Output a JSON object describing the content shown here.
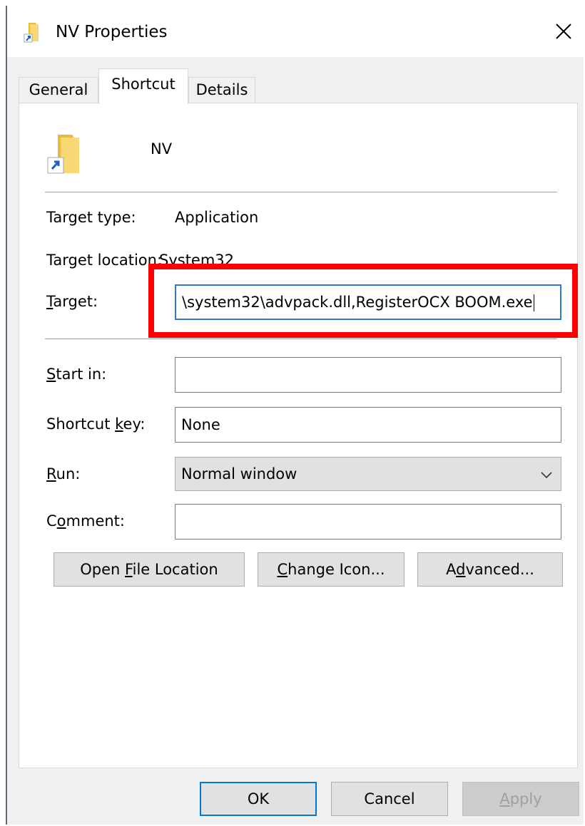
{
  "window": {
    "title": "NV Properties",
    "icons": {
      "title_icon": "folder-shortcut-icon",
      "close_icon": "close-icon",
      "shortcut_icon": "folder-shortcut-icon"
    }
  },
  "tabs": [
    {
      "label": "General",
      "active": false
    },
    {
      "label": "Shortcut",
      "active": true
    },
    {
      "label": "Details",
      "active": false
    }
  ],
  "shortcut": {
    "name": "NV",
    "target_type_label": "Target type:",
    "target_type_value": "Application",
    "target_location_label": "Target location:",
    "target_location_value": "System32",
    "target_label_pre": "",
    "target_label_underlined": "T",
    "target_label_post": "arget:",
    "target_value": "\\system32\\advpack.dll,RegisterOCX BOOM.exe",
    "start_in_label_underlined": "S",
    "start_in_label_post": "tart in:",
    "start_in_value": "",
    "shortcut_key_label_pre": "Shortcut ",
    "shortcut_key_label_underlined": "k",
    "shortcut_key_label_post": "ey:",
    "shortcut_key_value": "None",
    "run_label_underlined": "R",
    "run_label_post": "un:",
    "run_value": "Normal window",
    "comment_label_pre": "C",
    "comment_label_underlined": "o",
    "comment_label_post": "mment:",
    "comment_value": ""
  },
  "buttons": {
    "open_file_location_pre": "Open ",
    "open_file_location_underlined": "F",
    "open_file_location_post": "ile Location",
    "change_icon_underlined": "C",
    "change_icon_post": "hange Icon...",
    "advanced_pre": "A",
    "advanced_underlined": "d",
    "advanced_post": "vanced...",
    "ok": "OK",
    "cancel": "Cancel",
    "apply_underlined": "A",
    "apply_post": "pply"
  },
  "colors": {
    "highlight": "#ff0000",
    "focus_border": "#2f78d4",
    "default_button_border": "#0078d7"
  }
}
